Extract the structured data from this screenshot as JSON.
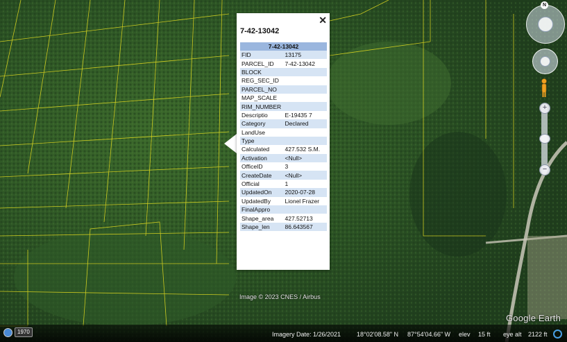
{
  "popup": {
    "title": "7-42-13042",
    "close": "✕",
    "table_header": "7-42-13042",
    "rows": [
      {
        "key": "FID",
        "value": "13175"
      },
      {
        "key": "PARCEL_ID",
        "value": "7-42-13042"
      },
      {
        "key": "BLOCK",
        "value": ""
      },
      {
        "key": "REG_SEC_ID",
        "value": ""
      },
      {
        "key": "PARCEL_NO",
        "value": ""
      },
      {
        "key": "MAP_SCALE",
        "value": ""
      },
      {
        "key": "RIM_NUMBER",
        "value": ""
      },
      {
        "key": "Descriptio",
        "value": "E-19435 7"
      },
      {
        "key": "Category",
        "value": "Declared"
      },
      {
        "key": "LandUse",
        "value": ""
      },
      {
        "key": "Type",
        "value": ""
      },
      {
        "key": "Calculated",
        "value": "427.532 S.M."
      },
      {
        "key": "Activation",
        "value": "<Null>"
      },
      {
        "key": "OfficeID",
        "value": "3"
      },
      {
        "key": "CreateDate",
        "value": "<Null>"
      },
      {
        "key": "Official",
        "value": "1"
      },
      {
        "key": "UpdatedOn",
        "value": "2020-07-28"
      },
      {
        "key": "UpdatedBy",
        "value": "Lionel Frazer"
      },
      {
        "key": "FinalAppro",
        "value": ""
      },
      {
        "key": "Shape_area",
        "value": "427.52713"
      },
      {
        "key": "Shape_len",
        "value": "86.643567"
      }
    ]
  },
  "map": {
    "credit": "Image © 2023 CNES / Airbus",
    "logo": "Google Earth"
  },
  "nav": {
    "north": "N",
    "zoom_in": "+",
    "zoom_out": "−"
  },
  "status": {
    "year": "1970",
    "imagery_date": "Imagery Date: 1/26/2021",
    "lat": "18°02'08.58\" N",
    "lon": "87°54'04.66\" W",
    "elev_label": "elev",
    "elev_value": "15 ft",
    "eye_alt_label": "eye alt",
    "eye_alt_value": "2122 ft"
  },
  "colors": {
    "parcel_line": "#e8e020",
    "forest": "#2a4a22",
    "table_header": "#9ab6de",
    "table_alt_row": "#d6e4f4"
  }
}
